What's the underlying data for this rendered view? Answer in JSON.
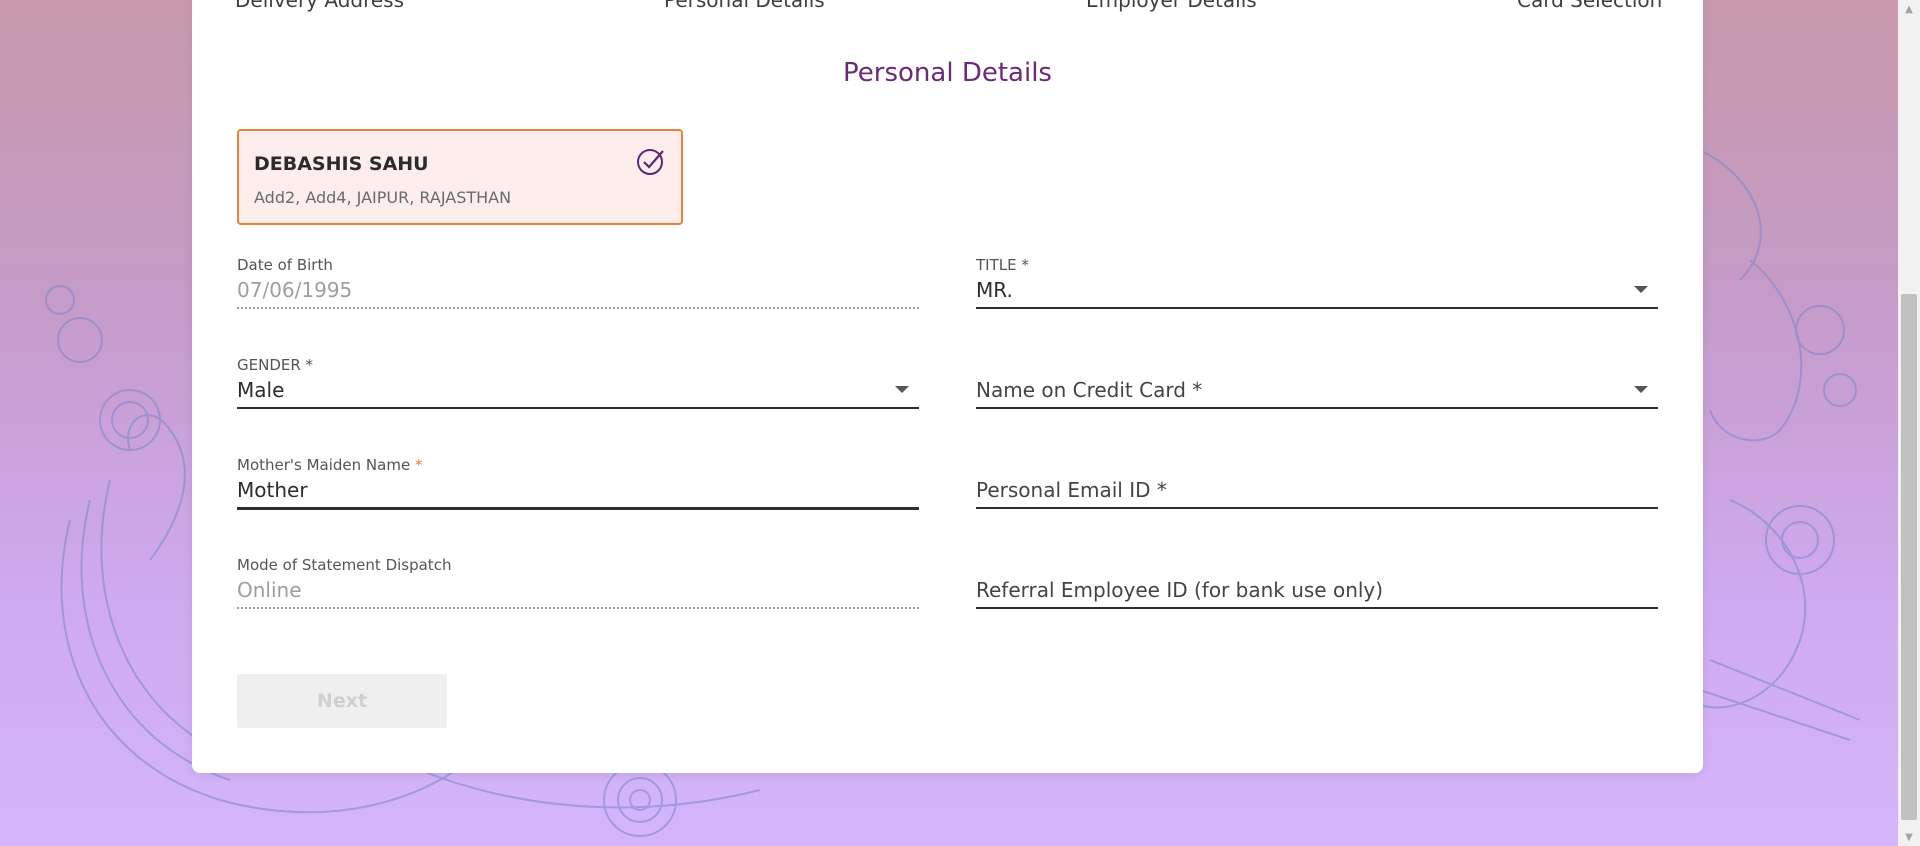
{
  "stepper": {
    "steps": [
      "Delivery Address",
      "Personal Details",
      "Employer Details",
      "Card Selection"
    ]
  },
  "section_title": "Personal Details",
  "profile": {
    "name": "DEBASHIS SAHU",
    "address": "Add2, Add4, JAIPUR, RAJASTHAN",
    "icon": "check-circle-icon"
  },
  "fields": {
    "dob": {
      "label": "Date of Birth",
      "value": "07/06/1995"
    },
    "title": {
      "label": "TITLE *",
      "value": "MR."
    },
    "gender": {
      "label": "GENDER *",
      "value": "Male"
    },
    "name_on_card": {
      "placeholder": "Name on Credit Card *"
    },
    "mothers_maiden": {
      "label": "Mother's Maiden Name",
      "required_mark": "*",
      "value": "Mother"
    },
    "personal_email": {
      "placeholder": "Personal Email ID *"
    },
    "statement_mode": {
      "label": "Mode of Statement Dispatch",
      "value": "Online"
    },
    "referral_id": {
      "placeholder": "Referral Employee ID (for bank use only)"
    }
  },
  "next_button": {
    "label": "Next",
    "disabled": true
  },
  "colors": {
    "accent": "#6b2a7a",
    "card_border": "#e8823a",
    "card_bg": "#fdeeed"
  }
}
